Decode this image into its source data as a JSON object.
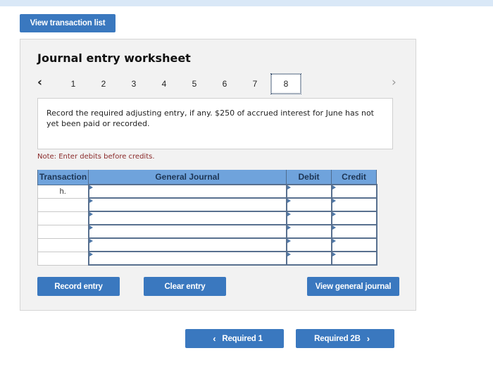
{
  "top_bar": {
    "color": "#d9e8f7"
  },
  "view_transaction_list_label": "View transaction list",
  "worksheet": {
    "title": "Journal entry worksheet",
    "pager": {
      "prev_icon": "‹",
      "next_icon": "›",
      "pages": [
        "1",
        "2",
        "3",
        "4",
        "5",
        "6",
        "7",
        "8"
      ],
      "active_page": "8"
    },
    "description": "Record the required adjusting entry, if any. $250 of accrued interest for June has not yet been paid or recorded.",
    "note": "Note: Enter debits before credits.",
    "table": {
      "headers": [
        "Transaction",
        "General Journal",
        "Debit",
        "Credit"
      ],
      "rows": [
        {
          "transaction": "h.",
          "account": "",
          "debit": "",
          "credit": ""
        },
        {
          "transaction": "",
          "account": "",
          "debit": "",
          "credit": ""
        },
        {
          "transaction": "",
          "account": "",
          "debit": "",
          "credit": ""
        },
        {
          "transaction": "",
          "account": "",
          "debit": "",
          "credit": ""
        },
        {
          "transaction": "",
          "account": "",
          "debit": "",
          "credit": ""
        },
        {
          "transaction": "",
          "account": "",
          "debit": "",
          "credit": ""
        }
      ]
    },
    "buttons": {
      "record": "Record entry",
      "clear": "Clear entry",
      "view_general_journal": "View general journal"
    }
  },
  "navigation": {
    "prev_label": "Required 1",
    "next_label": "Required 2B",
    "prev_icon": "‹",
    "next_icon": "›"
  },
  "colors": {
    "button_blue": "#3a78bf",
    "header_blue": "#6fa3dc",
    "note_red": "#8a2a2a",
    "panel_bg": "#f2f2f2"
  }
}
